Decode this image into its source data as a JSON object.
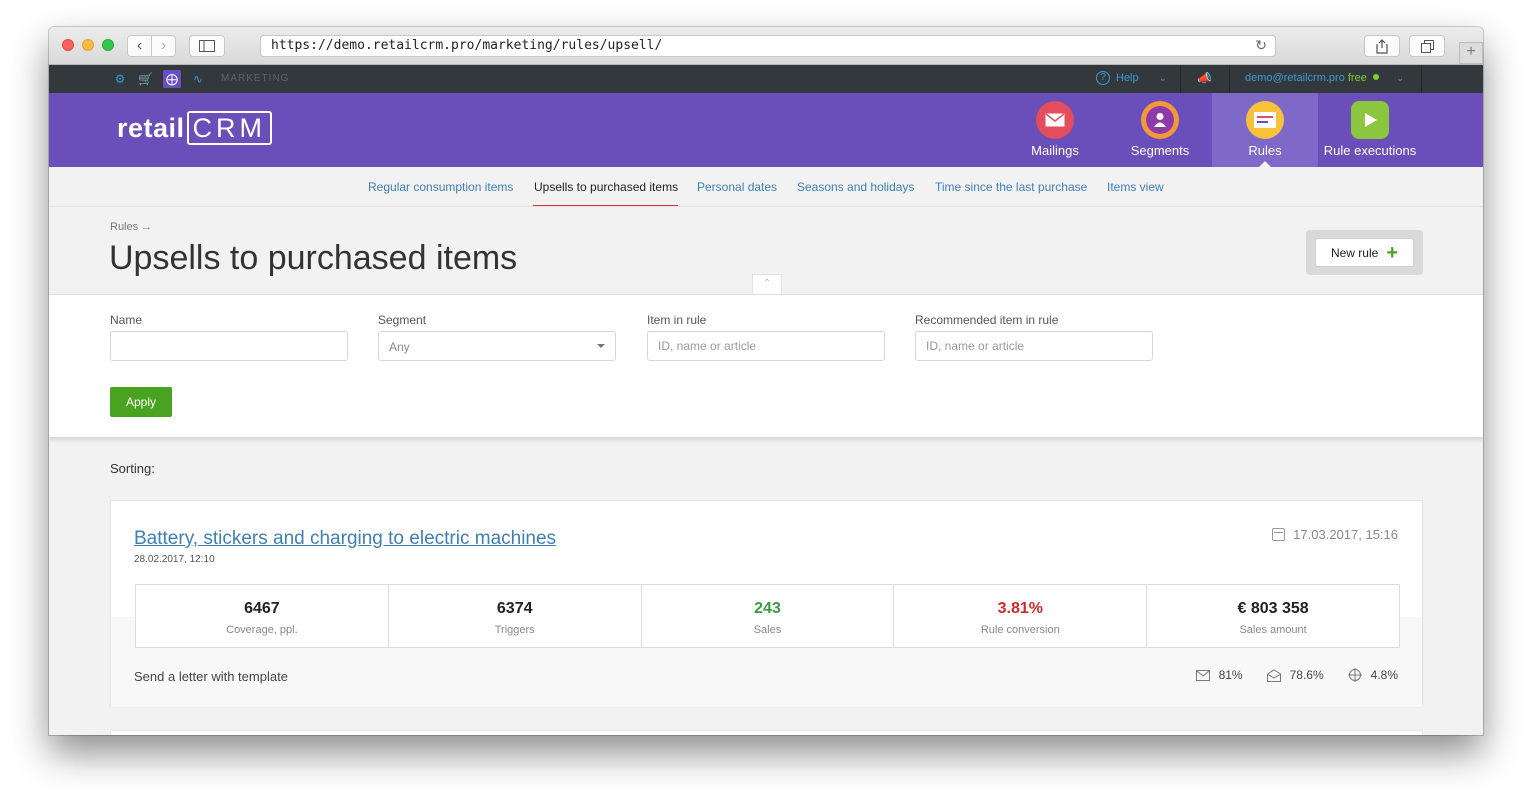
{
  "browser": {
    "url": "https://demo.retailcrm.pro/marketing/rules/upsell/"
  },
  "topbar": {
    "section": "MARKETING",
    "help_label": "Help",
    "user_email": "demo@retailcrm.pro",
    "plan": "free"
  },
  "header": {
    "logo_text": "retail",
    "logo_crm": "CRM",
    "modules": [
      {
        "label": "Mailings",
        "icon": "mailings-icon"
      },
      {
        "label": "Segments",
        "icon": "segments-icon"
      },
      {
        "label": "Rules",
        "icon": "rules-icon",
        "active": true
      },
      {
        "label": "Rule executions",
        "icon": "rule-executions-icon"
      }
    ]
  },
  "subnav": {
    "items": [
      {
        "label": "Regular consumption items"
      },
      {
        "label": "Upsells to purchased items",
        "active": true
      },
      {
        "label": "Personal dates"
      },
      {
        "label": "Seasons and holidays"
      },
      {
        "label": "Time since the last purchase"
      },
      {
        "label": "Items view"
      }
    ]
  },
  "page": {
    "breadcrumb": "Rules →",
    "title": "Upsells to purchased items",
    "new_rule_label": "New rule"
  },
  "filters": {
    "name_label": "Name",
    "name_value": "",
    "segment_label": "Segment",
    "segment_value": "Any",
    "item_label": "Item in rule",
    "item_placeholder": "ID, name or article",
    "recommended_label": "Recommended item in rule",
    "recommended_placeholder": "ID, name or article",
    "apply_label": "Apply"
  },
  "list": {
    "sorting_label": "Sorting:",
    "rules": [
      {
        "title": "Battery, stickers and charging to electric machines",
        "created": "28.02.2017, 12:10",
        "updated": "17.03.2017, 15:16",
        "stats": [
          {
            "value": "6467",
            "label": "Coverage, ppl."
          },
          {
            "value": "6374",
            "label": "Triggers"
          },
          {
            "value": "243",
            "label": "Sales"
          },
          {
            "value": "3.81%",
            "label": "Rule conversion"
          },
          {
            "value": "€ 803 358",
            "label": "Sales amount"
          }
        ],
        "action": "Send a letter with template",
        "metrics": [
          {
            "icon": "envelope-icon",
            "value": "81%"
          },
          {
            "icon": "envelope-open-icon",
            "value": "78.6%"
          },
          {
            "icon": "target-icon",
            "value": "4.8%"
          }
        ]
      }
    ]
  },
  "colors": {
    "brand_purple": "#6a4fba",
    "link_blue": "#3f7fb6",
    "apply_green": "#4aa320",
    "sales_green": "#3c9a3b",
    "conversion_red": "#cf2a2a"
  }
}
